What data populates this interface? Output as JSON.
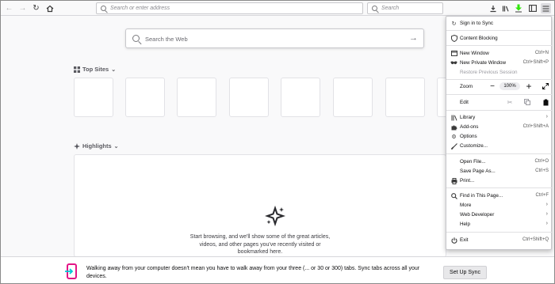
{
  "toolbar": {
    "url_placeholder": "Search or enter address",
    "search_placeholder": "Search"
  },
  "newtab": {
    "web_search_placeholder": "Search the Web",
    "top_sites_label": "Top Sites",
    "highlights_label": "Highlights",
    "highlights_empty_line1": "Start browsing, and we'll show some of the great articles,",
    "highlights_empty_line2": "videos, and other pages you've recently visited or",
    "highlights_empty_line3": "bookmarked here."
  },
  "menu": {
    "sign_in": "Sign in to Sync",
    "content_blocking": "Content Blocking",
    "new_window": "New Window",
    "new_window_sc": "Ctrl+N",
    "new_private": "New Private Window",
    "new_private_sc": "Ctrl+Shift+P",
    "restore": "Restore Previous Session",
    "zoom_label": "Zoom",
    "zoom_minus": "−",
    "zoom_value": "100%",
    "zoom_plus": "+",
    "edit_label": "Edit",
    "library": "Library",
    "addons": "Add-ons",
    "addons_sc": "Ctrl+Shift+A",
    "options": "Options",
    "customize": "Customize...",
    "open_file": "Open File...",
    "open_file_sc": "Ctrl+O",
    "save_page": "Save Page As...",
    "save_page_sc": "Ctrl+S",
    "print": "Print...",
    "find": "Find in This Page...",
    "find_sc": "Ctrl+F",
    "more": "More",
    "web_dev": "Web Developer",
    "help": "Help",
    "exit": "Exit",
    "exit_sc": "Ctrl+Shift+Q"
  },
  "notification": {
    "line1": "Walking away from your computer doesn't mean you have to walk away from your three (... or 30 or 300) tabs. Sync tabs across all your",
    "line2": "devices.",
    "button": "Set Up Sync"
  },
  "colors": {
    "accent": "#0a84ff",
    "download_arrow": "#30e60b",
    "sync_pink": "#e31587"
  }
}
